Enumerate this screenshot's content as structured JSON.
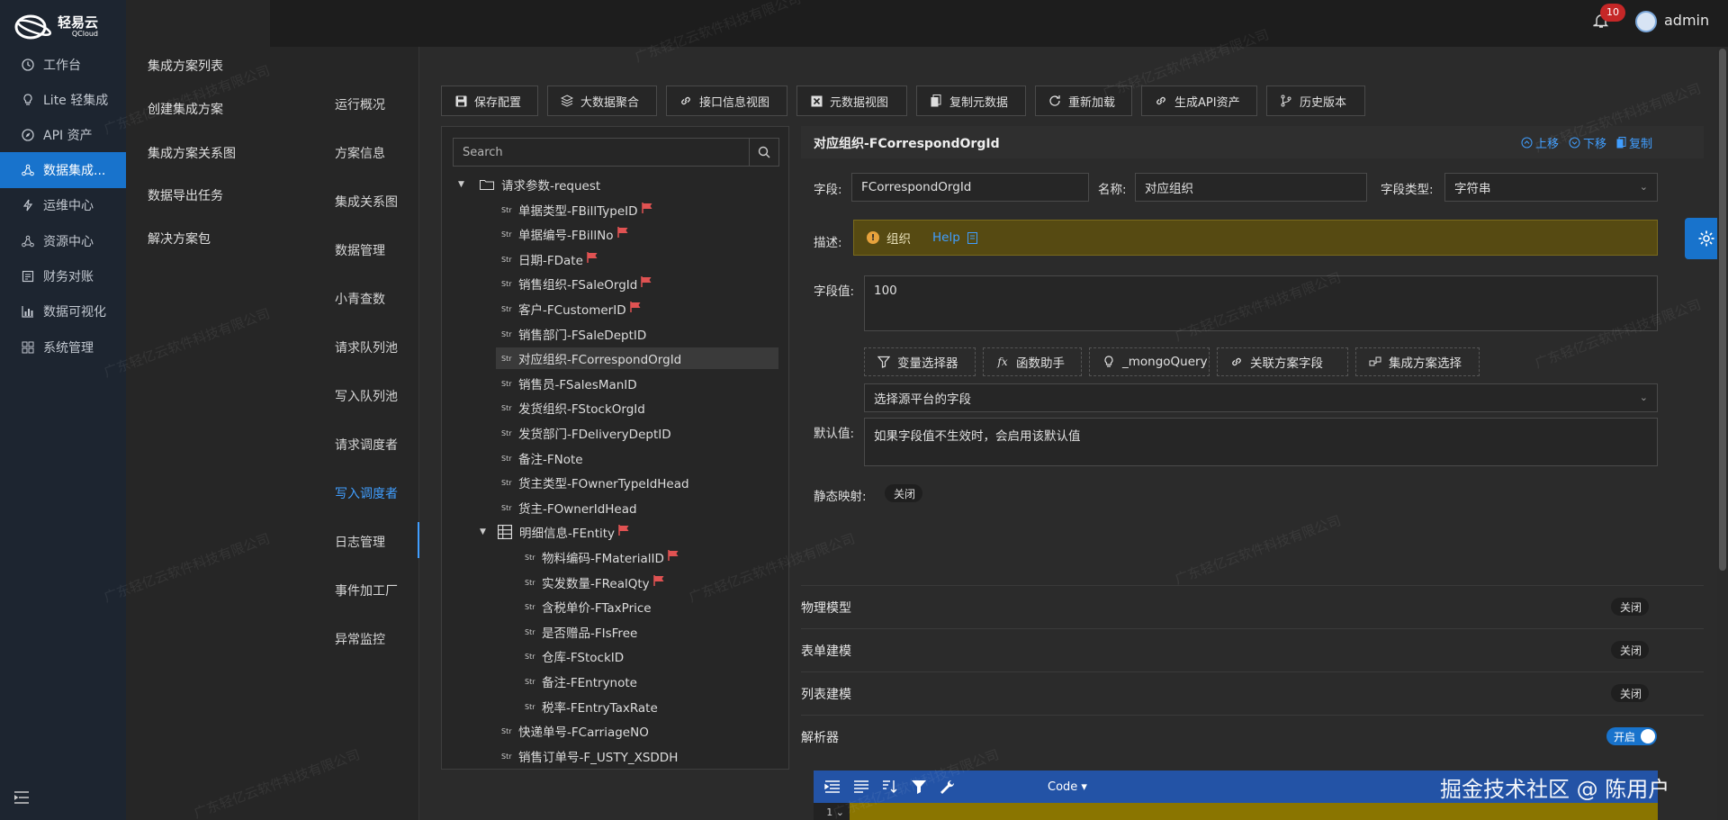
{
  "brand": {
    "name": "轻易云",
    "sub": "QCloud"
  },
  "nav": [
    {
      "label": "工作台",
      "icon": "clock-icon"
    },
    {
      "label": "Lite 轻集成",
      "icon": "bulb-icon"
    },
    {
      "label": "API 资产",
      "icon": "compass-icon"
    },
    {
      "label": "数据集成...",
      "icon": "share-icon",
      "active": true
    },
    {
      "label": "运维中心",
      "icon": "bolt-icon"
    },
    {
      "label": "资源中心",
      "icon": "share-icon"
    },
    {
      "label": "财务对账",
      "icon": "ledger-icon"
    },
    {
      "label": "数据可视化",
      "icon": "chart-icon"
    },
    {
      "label": "系统管理",
      "icon": "grid-icon"
    }
  ],
  "col2": [
    "集成方案列表",
    "创建集成方案",
    "集成方案关系图",
    "数据导出任务",
    "解决方案包"
  ],
  "col3": [
    "运行概况",
    "方案信息",
    "集成关系图",
    "数据管理",
    "小青查数",
    "请求队列池",
    "写入队列池",
    "请求调度者",
    "写入调度者",
    "日志管理",
    "事件加工厂",
    "异常监控"
  ],
  "col3_active": "写入调度者",
  "topbar": {
    "badge": "10",
    "user": "admin"
  },
  "toolbar": [
    {
      "label": "保存配置",
      "icon": "save-icon"
    },
    {
      "label": "大数据聚合",
      "icon": "layers-icon"
    },
    {
      "label": "接口信息视图",
      "icon": "link-icon"
    },
    {
      "label": "元数据视图",
      "icon": "excel-icon"
    },
    {
      "label": "复制元数据",
      "icon": "copy-icon"
    },
    {
      "label": "重新加载",
      "icon": "reload-icon"
    },
    {
      "label": "生成API资产",
      "icon": "link-icon"
    },
    {
      "label": "历史版本",
      "icon": "branch-icon"
    }
  ],
  "tree": {
    "search_placeholder": "Search",
    "root": "请求参数-request",
    "items": [
      {
        "label": "单据类型-FBillTypeID",
        "flag": true
      },
      {
        "label": "单据编号-FBillNo",
        "flag": true
      },
      {
        "label": "日期-FDate",
        "flag": true
      },
      {
        "label": "销售组织-FSaleOrgId",
        "flag": true
      },
      {
        "label": "客户-FCustomerID",
        "flag": true
      },
      {
        "label": "销售部门-FSaleDeptID",
        "flag": false
      },
      {
        "label": "对应组织-FCorrespondOrgId",
        "flag": false,
        "selected": true
      },
      {
        "label": "销售员-FSalesManID",
        "flag": false
      },
      {
        "label": "发货组织-FStockOrgId",
        "flag": false
      },
      {
        "label": "发货部门-FDeliveryDeptID",
        "flag": false
      },
      {
        "label": "备注-FNote",
        "flag": false
      },
      {
        "label": "货主类型-FOwnerTypeIdHead",
        "flag": false
      },
      {
        "label": "货主-FOwnerIdHead",
        "flag": false
      }
    ],
    "entity": "明细信息-FEntity",
    "entity_items": [
      {
        "label": "物料编码-FMaterialID",
        "flag": true
      },
      {
        "label": "实发数量-FRealQty",
        "flag": true
      },
      {
        "label": "含税单价-FTaxPrice",
        "flag": false
      },
      {
        "label": "是否赠品-FIsFree",
        "flag": false
      },
      {
        "label": "仓库-FStockID",
        "flag": false
      },
      {
        "label": "备注-FEntrynote",
        "flag": false
      },
      {
        "label": "税率-FEntryTaxRate",
        "flag": false
      }
    ],
    "tail_items": [
      {
        "label": "快递单号-FCarriageNO",
        "flag": false
      },
      {
        "label": "销售订单号-F_USTY_XSDDH",
        "flag": false
      }
    ],
    "str_tag": "Str"
  },
  "detail": {
    "title": "对应组织-FCorrespondOrgId",
    "actions": {
      "up": "上移",
      "down": "下移",
      "copy": "复制"
    },
    "field_label": "字段:",
    "field_value": "FCorrespondOrgId",
    "name_label": "名称:",
    "name_value": "对应组织",
    "type_label": "字段类型:",
    "type_value": "字符串",
    "desc_label": "描述:",
    "desc_text": "组织",
    "desc_help": "Help",
    "value_label": "字段值:",
    "value_text": "100",
    "chips": [
      {
        "label": "变量选择器",
        "icon": "filter-icon"
      },
      {
        "label": "函数助手",
        "icon": "fx-icon"
      },
      {
        "label": "_mongoQuery",
        "icon": "bulb-icon"
      },
      {
        "label": "关联方案字段",
        "icon": "link-icon"
      },
      {
        "label": "集成方案选择",
        "icon": "nodes-icon"
      }
    ],
    "source_placeholder": "选择源平台的字段",
    "default_label": "默认值:",
    "default_placeholder": "如果字段值不生效时，会启用该默认值",
    "static_label": "静态映射:",
    "static_value": "关闭",
    "sections": [
      {
        "label": "物理模型",
        "value": "关闭",
        "on": false
      },
      {
        "label": "表单建模",
        "value": "关闭",
        "on": false
      },
      {
        "label": "列表建模",
        "value": "关闭",
        "on": false
      },
      {
        "label": "解析器",
        "value": "开启",
        "on": true
      }
    ],
    "editor": {
      "mode": "Code",
      "line": "1"
    }
  },
  "watermark": "掘金技术社区 @ 陈用户",
  "tile_watermark": "广东轻亿云软件科技有限公司",
  "colors": {
    "accent": "#1873cc",
    "link": "#409eff",
    "warning_bg": "#564a12"
  }
}
